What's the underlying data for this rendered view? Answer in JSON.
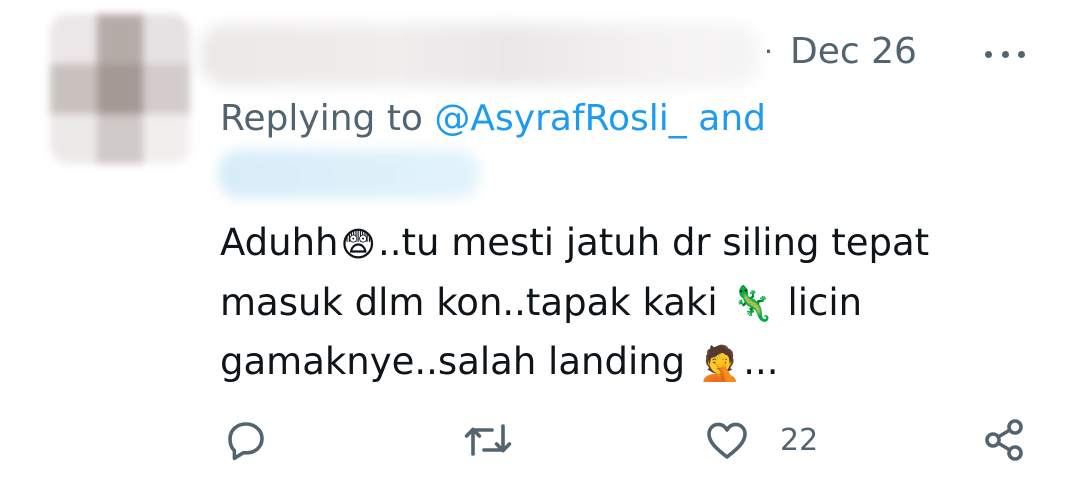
{
  "tweet": {
    "date_separator": "·",
    "date": "Dec 26",
    "replying_prefix": "Replying to ",
    "replying_mention": "@AsyrafRosli_",
    "replying_and": " and",
    "text_lines": [
      {
        "before": "Aduhh",
        "emoji": "😨",
        "after": "..tu mesti jatuh dr siling tepat"
      },
      {
        "before": "masuk dlm kon..tapak kaki ",
        "emoji": "🦎",
        "after": " licin"
      },
      {
        "before": "gamaknye..salah landing ",
        "emoji": "🤦",
        "after": "..."
      }
    ]
  },
  "actions": {
    "reply_icon": "reply-icon",
    "retweet_icon": "retweet-icon",
    "like_icon": "heart-icon",
    "like_count": "22",
    "share_icon": "share-icon"
  },
  "colors": {
    "text": "#0f1419",
    "secondary": "#536471",
    "link": "#1d9bf0"
  }
}
